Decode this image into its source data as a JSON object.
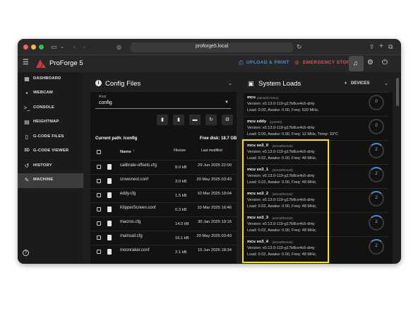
{
  "browser": {
    "url": "proforge5.local"
  },
  "app": {
    "title": "ProForge 5",
    "upload_label": "UPLOAD & PRINT",
    "emergency_label": "EMERGENCY STOP"
  },
  "colors": {
    "accent_blue": "#4a8fd6",
    "emergency_red": "#e05454",
    "highlight_yellow": "#ffe600"
  },
  "sidebar": {
    "items": [
      {
        "label": "DASHBOARD",
        "icon": "dashboard-icon"
      },
      {
        "label": "WEBCAM",
        "icon": "webcam-icon"
      },
      {
        "label": "CONSOLE",
        "icon": "console-icon"
      },
      {
        "label": "HEIGHTMAP",
        "icon": "heightmap-icon"
      },
      {
        "label": "G-CODE FILES",
        "icon": "file-icon"
      },
      {
        "label": "G-CODE VIEWER",
        "icon": "3d-icon"
      },
      {
        "label": "HISTORY",
        "icon": "history-icon"
      },
      {
        "label": "MACHINE",
        "icon": "wrench-icon"
      }
    ]
  },
  "config": {
    "title": "Config Files",
    "root_label": "Root",
    "root_value": "config",
    "current_path": "Current path: /config",
    "free_disk": "Free disk: 18.7 GB",
    "columns": {
      "name": "Name",
      "filesize": "Filesize",
      "modified": "Last modified"
    },
    "files": [
      {
        "name": "calibrate-offsets.cfg",
        "size": "8.0 kB",
        "modified": "29 Jun 2025 22:00"
      },
      {
        "name": "crowsnest.conf",
        "size": "3.0 kB",
        "modified": "20 May 2025 03:40"
      },
      {
        "name": "eddy.cfg",
        "size": "1.5 kB",
        "modified": "10 Mar 2025 19:04"
      },
      {
        "name": "KlipperScreen.conf",
        "size": "0.3 kB",
        "modified": "10 Mar 2025 16:46"
      },
      {
        "name": "macros.cfg",
        "size": "14.0 kB",
        "modified": "30 Jan 2025 19:16"
      },
      {
        "name": "mainsail.cfg",
        "size": "16.1 kB",
        "modified": "20 May 2025 03:40"
      },
      {
        "name": "moonraker.conf",
        "size": "2.1 kB",
        "modified": "15 Jun 2025 18:34"
      }
    ]
  },
  "loads": {
    "title": "System Loads",
    "devices_label": "DEVICES",
    "mcus": [
      {
        "name": "mcu",
        "chip": "(stm32h723xx)",
        "version": "Version: v0.13.0-119-g17b8ce4c6-dirty",
        "load": "Load: 0.00, Awake: 0.00, Freq: 520 MHz,",
        "value": "0"
      },
      {
        "name": "mcu eddy",
        "chip": "(rp2040)",
        "version": "Version: v0.13.0-119-g17b8ce4c6-dirty",
        "load": "Load: 0.00, Awake: 0.00, Freq: 12 MHz, Temp: 33°C",
        "value": "0"
      },
      {
        "name": "mcu so3_0",
        "chip": "(stm32f042x6)",
        "version": "Version: v0.13.0-119-g17b8ce4c6-dirty",
        "load": "Load: 0.02, Awake: 0.00, Freq: 48 MHz,",
        "value": "2"
      },
      {
        "name": "mcu so3_1",
        "chip": "(stm32f042x6)",
        "version": "Version: v0.13.0-119-g17b8ce4c6-dirty",
        "load": "Load: 0.02, Awake: 0.00, Freq: 48 MHz,",
        "value": "2"
      },
      {
        "name": "mcu so3_2",
        "chip": "(stm32f042x6)",
        "version": "Version: v0.13.0-119-g17b8ce4c6-dirty",
        "load": "Load: 0.02, Awake: 0.00, Freq: 48 MHz,",
        "value": "2"
      },
      {
        "name": "mcu so3_3",
        "chip": "(stm32f042x6)",
        "version": "Version: v0.13.0-119-g17b8ce4c6-dirty",
        "load": "Load: 0.02, Awake: 0.00, Freq: 48 MHz,",
        "value": "2"
      },
      {
        "name": "mcu so3_4",
        "chip": "(stm32f042x6)",
        "version": "Version: v0.13.0-119-g17b8ce4c6-dirty",
        "load": "Load: 0.02, Awake: 0.00, Freq: 48 MHz,",
        "value": "2"
      }
    ]
  }
}
